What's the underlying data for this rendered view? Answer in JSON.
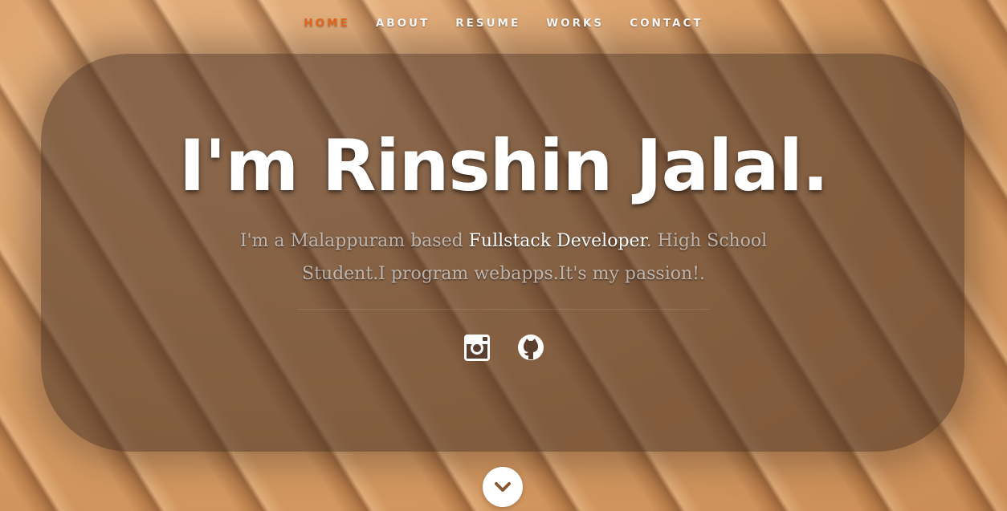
{
  "nav": {
    "items": [
      {
        "label": "HOME",
        "active": true
      },
      {
        "label": "ABOUT",
        "active": false
      },
      {
        "label": "RESUME",
        "active": false
      },
      {
        "label": "WORKS",
        "active": false
      },
      {
        "label": "CONTACT",
        "active": false
      }
    ],
    "active_color": "#e8691d"
  },
  "hero": {
    "headline": "I'm Rinshin Jalal.",
    "tagline_part1": "I'm a Malappuram based ",
    "tagline_highlight": "Fullstack Developer",
    "tagline_part2": ". High School Student.I program webapps.It's my passion!."
  },
  "social": [
    {
      "icon": "instagram-icon"
    },
    {
      "icon": "github-icon"
    }
  ],
  "scroll_down": {
    "icon": "chevron-down-icon"
  },
  "colors": {
    "accent": "#e8691d",
    "chevron": "#8a5a36"
  }
}
